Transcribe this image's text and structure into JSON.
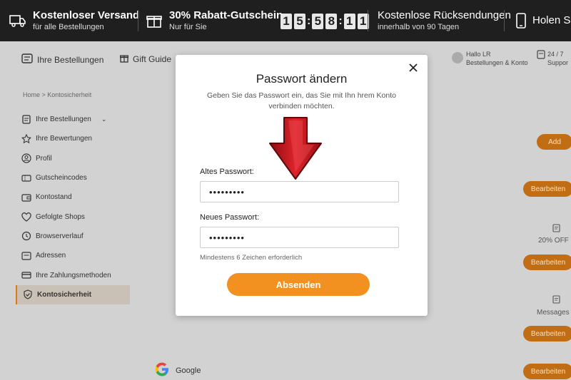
{
  "promo": {
    "shipping_title": "Kostenloser Versand",
    "shipping_sub": "für alle Bestellungen",
    "coupon_title": "30% Rabatt-Gutschein",
    "coupon_sub": "Nur für Sie",
    "countdown": [
      "1",
      "5",
      "5",
      "8",
      "1",
      "1"
    ],
    "returns_title": "Kostenlose Rücksendungen",
    "returns_sub": "innerhalb von 90 Tagen",
    "app_title": "Holen S"
  },
  "nav": {
    "orders": "Ihre Bestellungen",
    "gift": "Gift Guide",
    "hello": "Hallo LR",
    "account": "Bestellungen & Konto",
    "support_top": "24 / 7",
    "support_bottom": "Suppor"
  },
  "breadcrumb": "Home > Kontosicherheit",
  "sidebar": {
    "items": [
      {
        "label": "Ihre Bestellungen"
      },
      {
        "label": "Ihre Bewertungen"
      },
      {
        "label": "Profil"
      },
      {
        "label": "Gutscheincodes"
      },
      {
        "label": "Kontostand"
      },
      {
        "label": "Gefolgte Shops"
      },
      {
        "label": "Browserverlauf"
      },
      {
        "label": "Adressen"
      },
      {
        "label": "Ihre Zahlungsmethoden"
      },
      {
        "label": "Kontosicherheit"
      }
    ]
  },
  "right": {
    "add": "Add",
    "edit": "Bearbeiten",
    "off": "20% OFF",
    "messages": "Messages",
    "google": "Google"
  },
  "modal": {
    "title": "Passwort ändern",
    "subtitle": "Geben Sie das Passwort ein, das Sie mit Ihn hrem Konto verbinden möchten.",
    "old_label": "Altes Passwort:",
    "old_value": "•••••••••",
    "new_label": "Neues Passwort:",
    "new_value": "•••••••••",
    "hint": "Mindestens 6 Zeichen erforderlich",
    "submit": "Absenden"
  },
  "colors": {
    "accent": "#f29120",
    "arrow": "#c8141c",
    "topbar": "#1f1f1f"
  }
}
